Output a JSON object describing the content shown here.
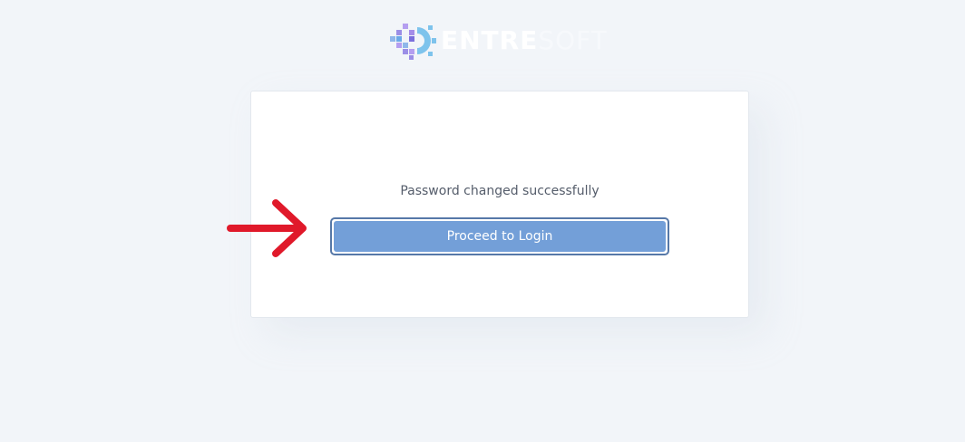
{
  "logo": {
    "text_bold": "ENTRE",
    "text_light": "SOFT"
  },
  "card": {
    "message": "Password changed successfully",
    "button_label": "Proceed to Login"
  },
  "colors": {
    "page_background": "#f2f5f9",
    "button_fill": "#739fd8",
    "button_border": "#5678a8",
    "annotation_arrow": "#e0192a"
  },
  "icons": {
    "logo_mark": "entresoft-logo-icon",
    "annotation": "red-arrow-icon"
  }
}
